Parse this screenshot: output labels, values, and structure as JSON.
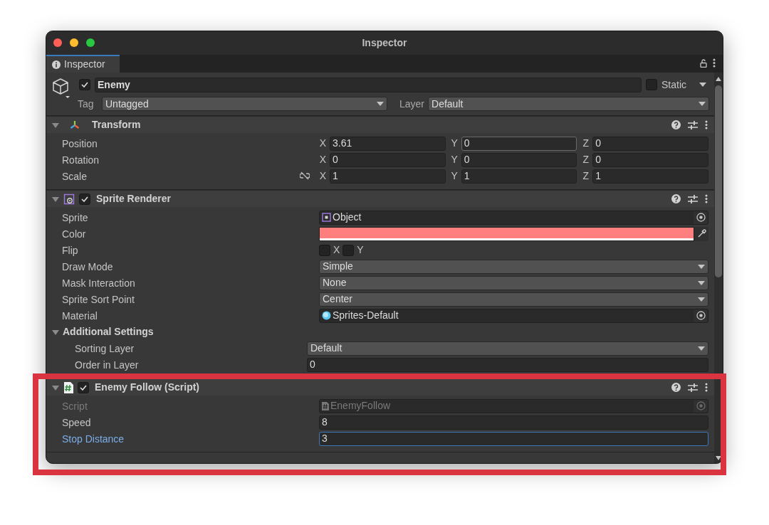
{
  "window": {
    "title": "Inspector"
  },
  "tabs": [
    {
      "label": "Inspector",
      "selected": true
    }
  ],
  "game_object": {
    "active": true,
    "name": "Enemy",
    "static": false,
    "static_label": "Static",
    "tag_label": "Tag",
    "tag": "Untagged",
    "layer_label": "Layer",
    "layer": "Default"
  },
  "components": [
    {
      "kind": "transform",
      "title": "Transform",
      "expanded": true,
      "fields": [
        {
          "kind": "vector3",
          "label": "Position",
          "axes": [
            {
              "axis": "X",
              "value": "3.61",
              "hovered": false
            },
            {
              "axis": "Y",
              "value": "0",
              "hovered": true
            },
            {
              "axis": "Z",
              "value": "0",
              "hovered": false
            }
          ]
        },
        {
          "kind": "vector3",
          "label": "Rotation",
          "axes": [
            {
              "axis": "X",
              "value": "0",
              "hovered": false
            },
            {
              "axis": "Y",
              "value": "0",
              "hovered": false
            },
            {
              "axis": "Z",
              "value": "0",
              "hovered": false
            }
          ]
        },
        {
          "kind": "vector3",
          "label": "Scale",
          "linked": false,
          "axes": [
            {
              "axis": "X",
              "value": "1",
              "hovered": false
            },
            {
              "axis": "Y",
              "value": "1",
              "hovered": false
            },
            {
              "axis": "Z",
              "value": "1",
              "hovered": false
            }
          ]
        }
      ]
    },
    {
      "kind": "sprite_renderer",
      "title": "Sprite Renderer",
      "expanded": true,
      "enabled": true,
      "fields": [
        {
          "kind": "object",
          "label": "Sprite",
          "value": "Object",
          "asset": {
            "kind": "sprite"
          },
          "disabled": false
        },
        {
          "kind": "color",
          "label": "Color",
          "color": "#ff7f7f"
        },
        {
          "kind": "toggles",
          "label": "Flip",
          "toggles": [
            {
              "label": "X",
              "checked": false
            },
            {
              "label": "Y",
              "checked": false
            }
          ]
        },
        {
          "kind": "dropdown",
          "label": "Draw Mode",
          "value": "Simple"
        },
        {
          "kind": "dropdown",
          "label": "Mask Interaction",
          "value": "None"
        },
        {
          "kind": "dropdown",
          "label": "Sprite Sort Point",
          "value": "Center"
        },
        {
          "kind": "object",
          "label": "Material",
          "value": "Sprites-Default",
          "asset": {
            "kind": "material"
          },
          "disabled": false
        },
        {
          "kind": "foldout",
          "label": "Additional Settings",
          "expanded": true,
          "children": [
            {
              "kind": "dropdown",
              "label": "Sorting Layer",
              "value": "Default"
            },
            {
              "kind": "number",
              "label": "Order in Layer",
              "value": "0",
              "focused": false
            }
          ]
        }
      ]
    },
    {
      "kind": "script",
      "title": "Enemy Follow (Script)",
      "expanded": true,
      "enabled": true,
      "fields": [
        {
          "kind": "object",
          "label": "Script",
          "value": "EnemyFollow",
          "asset": {
            "kind": "script"
          },
          "disabled": true
        },
        {
          "kind": "number",
          "label": "Speed",
          "value": "8",
          "focused": false
        },
        {
          "kind": "number",
          "label": "Stop Distance",
          "value": "3",
          "focused": true
        }
      ]
    }
  ]
}
